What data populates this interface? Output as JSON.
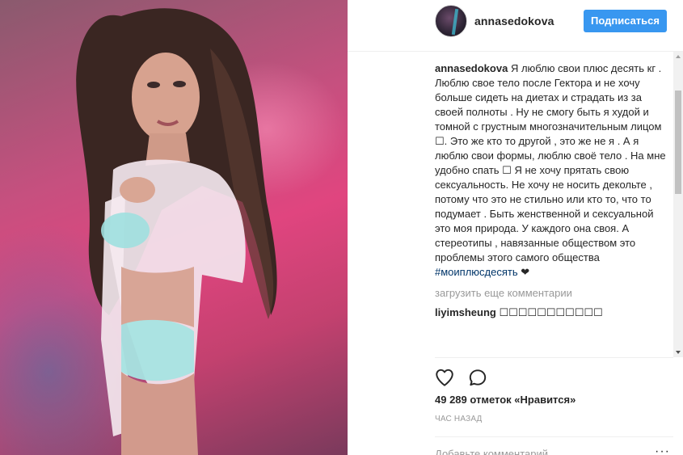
{
  "post": {
    "username": "annasedokova",
    "follow_label": "Подписаться",
    "caption_username": "annasedokova",
    "caption_text": " Я люблю свои плюс десять кг . Люблю свое тело после Гектора и не хочу больше сидеть на диетах и страдать из за своей полноты . Ну не смогу быть я худой и томной с грустным многозначительным лицом ☐. Это же кто то другой , это же не я . А я люблю свои формы, люблю своё тело . На мне удобно спать ☐ Я не хочу прятать свою сексуальность. Не хочу не носить декольте , потому что это не стильно или кто то, что то подумает . Быть женственной и сексуальной это моя природа. У каждого она своя. А стереотипы , навязанные обществом это проблемы этого самого общества ",
    "hashtag": "#моиплюсдесять",
    "caption_end": " ❤",
    "load_more_label": "загрузить еще комментарии",
    "comment": {
      "username": "liyimsheung",
      "text": " ☐☐☐☐☐☐☐☐☐☐☐"
    },
    "likes": "49 289 отметок «Нравится»",
    "timestamp": "час назад",
    "add_comment_placeholder": "Добавьте комментарий...",
    "more_label": "···"
  },
  "icons": {
    "like": "heart-outline-icon",
    "comment": "speech-bubble-icon",
    "more": "more-options-icon"
  },
  "colors": {
    "accent": "#3897f0",
    "hashtag": "#003569",
    "muted": "#999999"
  }
}
